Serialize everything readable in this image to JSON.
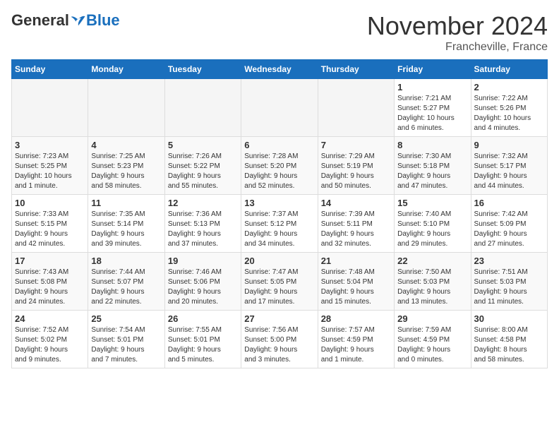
{
  "header": {
    "logo_general": "General",
    "logo_blue": "Blue",
    "month_title": "November 2024",
    "location": "Francheville, France"
  },
  "weekdays": [
    "Sunday",
    "Monday",
    "Tuesday",
    "Wednesday",
    "Thursday",
    "Friday",
    "Saturday"
  ],
  "weeks": [
    [
      {
        "day": "",
        "info": ""
      },
      {
        "day": "",
        "info": ""
      },
      {
        "day": "",
        "info": ""
      },
      {
        "day": "",
        "info": ""
      },
      {
        "day": "",
        "info": ""
      },
      {
        "day": "1",
        "info": "Sunrise: 7:21 AM\nSunset: 5:27 PM\nDaylight: 10 hours\nand 6 minutes."
      },
      {
        "day": "2",
        "info": "Sunrise: 7:22 AM\nSunset: 5:26 PM\nDaylight: 10 hours\nand 4 minutes."
      }
    ],
    [
      {
        "day": "3",
        "info": "Sunrise: 7:23 AM\nSunset: 5:25 PM\nDaylight: 10 hours\nand 1 minute."
      },
      {
        "day": "4",
        "info": "Sunrise: 7:25 AM\nSunset: 5:23 PM\nDaylight: 9 hours\nand 58 minutes."
      },
      {
        "day": "5",
        "info": "Sunrise: 7:26 AM\nSunset: 5:22 PM\nDaylight: 9 hours\nand 55 minutes."
      },
      {
        "day": "6",
        "info": "Sunrise: 7:28 AM\nSunset: 5:20 PM\nDaylight: 9 hours\nand 52 minutes."
      },
      {
        "day": "7",
        "info": "Sunrise: 7:29 AM\nSunset: 5:19 PM\nDaylight: 9 hours\nand 50 minutes."
      },
      {
        "day": "8",
        "info": "Sunrise: 7:30 AM\nSunset: 5:18 PM\nDaylight: 9 hours\nand 47 minutes."
      },
      {
        "day": "9",
        "info": "Sunrise: 7:32 AM\nSunset: 5:17 PM\nDaylight: 9 hours\nand 44 minutes."
      }
    ],
    [
      {
        "day": "10",
        "info": "Sunrise: 7:33 AM\nSunset: 5:15 PM\nDaylight: 9 hours\nand 42 minutes."
      },
      {
        "day": "11",
        "info": "Sunrise: 7:35 AM\nSunset: 5:14 PM\nDaylight: 9 hours\nand 39 minutes."
      },
      {
        "day": "12",
        "info": "Sunrise: 7:36 AM\nSunset: 5:13 PM\nDaylight: 9 hours\nand 37 minutes."
      },
      {
        "day": "13",
        "info": "Sunrise: 7:37 AM\nSunset: 5:12 PM\nDaylight: 9 hours\nand 34 minutes."
      },
      {
        "day": "14",
        "info": "Sunrise: 7:39 AM\nSunset: 5:11 PM\nDaylight: 9 hours\nand 32 minutes."
      },
      {
        "day": "15",
        "info": "Sunrise: 7:40 AM\nSunset: 5:10 PM\nDaylight: 9 hours\nand 29 minutes."
      },
      {
        "day": "16",
        "info": "Sunrise: 7:42 AM\nSunset: 5:09 PM\nDaylight: 9 hours\nand 27 minutes."
      }
    ],
    [
      {
        "day": "17",
        "info": "Sunrise: 7:43 AM\nSunset: 5:08 PM\nDaylight: 9 hours\nand 24 minutes."
      },
      {
        "day": "18",
        "info": "Sunrise: 7:44 AM\nSunset: 5:07 PM\nDaylight: 9 hours\nand 22 minutes."
      },
      {
        "day": "19",
        "info": "Sunrise: 7:46 AM\nSunset: 5:06 PM\nDaylight: 9 hours\nand 20 minutes."
      },
      {
        "day": "20",
        "info": "Sunrise: 7:47 AM\nSunset: 5:05 PM\nDaylight: 9 hours\nand 17 minutes."
      },
      {
        "day": "21",
        "info": "Sunrise: 7:48 AM\nSunset: 5:04 PM\nDaylight: 9 hours\nand 15 minutes."
      },
      {
        "day": "22",
        "info": "Sunrise: 7:50 AM\nSunset: 5:03 PM\nDaylight: 9 hours\nand 13 minutes."
      },
      {
        "day": "23",
        "info": "Sunrise: 7:51 AM\nSunset: 5:03 PM\nDaylight: 9 hours\nand 11 minutes."
      }
    ],
    [
      {
        "day": "24",
        "info": "Sunrise: 7:52 AM\nSunset: 5:02 PM\nDaylight: 9 hours\nand 9 minutes."
      },
      {
        "day": "25",
        "info": "Sunrise: 7:54 AM\nSunset: 5:01 PM\nDaylight: 9 hours\nand 7 minutes."
      },
      {
        "day": "26",
        "info": "Sunrise: 7:55 AM\nSunset: 5:01 PM\nDaylight: 9 hours\nand 5 minutes."
      },
      {
        "day": "27",
        "info": "Sunrise: 7:56 AM\nSunset: 5:00 PM\nDaylight: 9 hours\nand 3 minutes."
      },
      {
        "day": "28",
        "info": "Sunrise: 7:57 AM\nSunset: 4:59 PM\nDaylight: 9 hours\nand 1 minute."
      },
      {
        "day": "29",
        "info": "Sunrise: 7:59 AM\nSunset: 4:59 PM\nDaylight: 9 hours\nand 0 minutes."
      },
      {
        "day": "30",
        "info": "Sunrise: 8:00 AM\nSunset: 4:58 PM\nDaylight: 8 hours\nand 58 minutes."
      }
    ]
  ]
}
